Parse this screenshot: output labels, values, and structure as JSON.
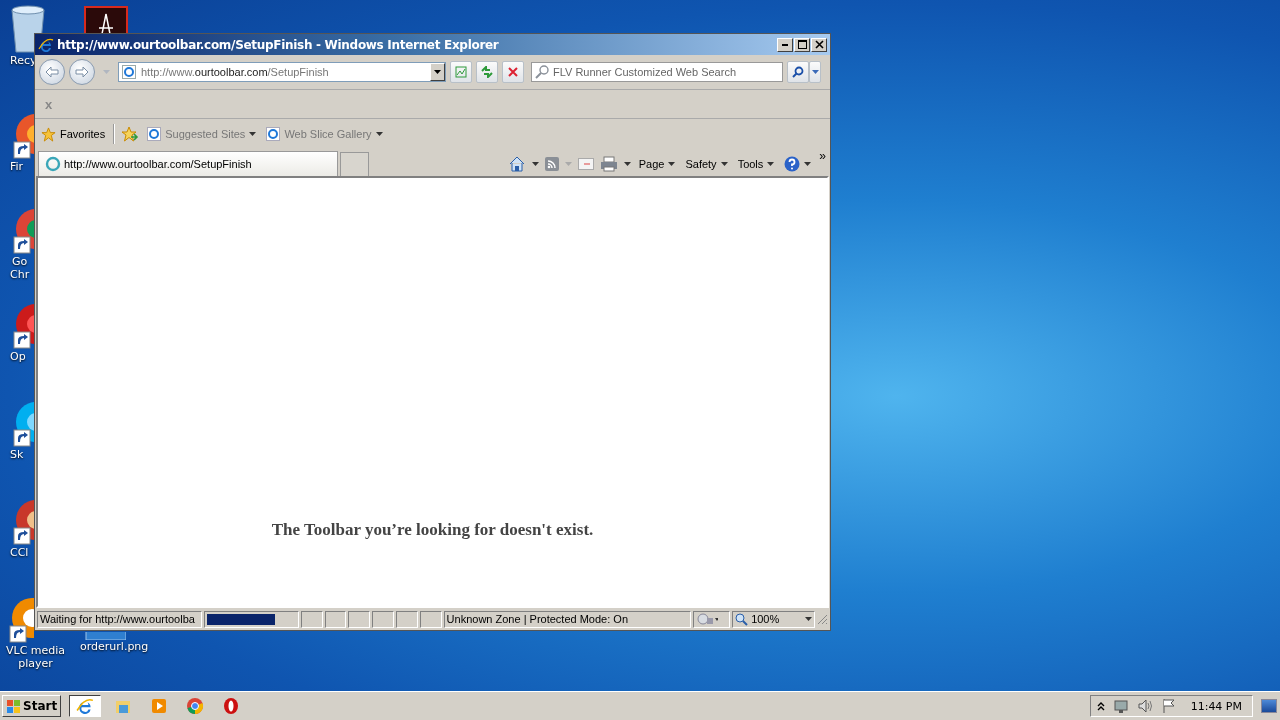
{
  "desktop": {
    "icons": [
      {
        "kind": "recycle-bin",
        "lines": [
          "Recy"
        ],
        "shortcut": false
      },
      {
        "kind": "pdf",
        "shortcut": false
      },
      {
        "kind": "firefox",
        "lines": [
          "Fir"
        ],
        "shortcut": true
      },
      {
        "kind": "chrome",
        "lines": [
          "Go",
          "Chr"
        ],
        "shortcut": true
      },
      {
        "kind": "opera",
        "lines": [
          "Op"
        ],
        "shortcut": true
      },
      {
        "kind": "skype",
        "lines": [
          "Sk"
        ],
        "shortcut": true
      },
      {
        "kind": "ccleaner",
        "lines": [
          "CCl"
        ],
        "shortcut": true
      },
      {
        "kind": "vlc",
        "lines": [
          "VLC media",
          "player"
        ],
        "shortcut": true
      },
      {
        "kind": "image",
        "lines": [
          "orderurl.png"
        ],
        "shortcut": false
      }
    ]
  },
  "window": {
    "title": "http://www.ourtoolbar.com/SetupFinish - Windows Internet Explorer",
    "address": {
      "prefix": "http://www.",
      "domain": "ourtoolbar.com",
      "path": "/SetupFinish"
    },
    "search": {
      "placeholder": "FLV Runner Customized Web Search"
    },
    "notification": {
      "close": "x"
    },
    "favorites": {
      "label": "Favorites",
      "items": [
        {
          "label": "Suggested Sites"
        },
        {
          "label": "Web Slice Gallery"
        }
      ]
    },
    "tabs": [
      {
        "title": "http://www.ourtoolbar.com/SetupFinish",
        "selected": true
      }
    ],
    "commands": [
      {
        "label": "Page"
      },
      {
        "label": "Safety"
      },
      {
        "label": "Tools"
      }
    ],
    "overflow": "»",
    "page": {
      "message": "The Toolbar you’re looking for doesn't exist."
    },
    "status_bar": {
      "text": "Waiting for http://www.ourtoolba",
      "level": 0.77,
      "zone": "Unknown Zone | Protected Mode: On",
      "zoom": "100%"
    }
  },
  "taskbar": {
    "start": "Start",
    "apps": [
      {
        "kind": "ie",
        "selected": true
      },
      {
        "kind": "explorer",
        "selected": false
      },
      {
        "kind": "media",
        "selected": false
      },
      {
        "kind": "chrome",
        "selected": false
      },
      {
        "kind": "opera",
        "selected": false
      }
    ],
    "clock": "11:44 PM"
  }
}
